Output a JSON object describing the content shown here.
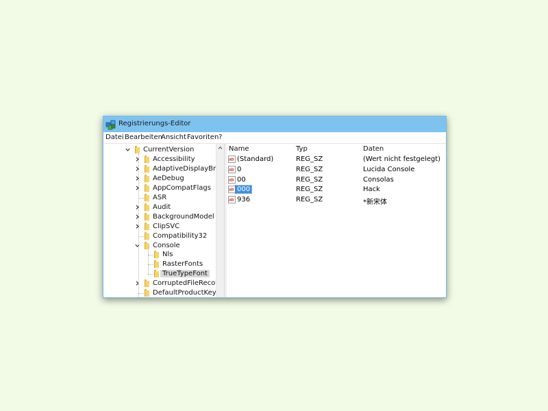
{
  "window": {
    "title": "Registrierungs-Editor"
  },
  "menu": [
    "Datei",
    "Bearbeiten",
    "Ansicht",
    "Favoriten",
    "?"
  ],
  "tree": [
    {
      "label": "CurrentVersion",
      "level": 0,
      "chevron": "down"
    },
    {
      "label": "Accessibility",
      "level": 1,
      "chevron": "right"
    },
    {
      "label": "AdaptiveDisplayBrigl",
      "level": 1,
      "chevron": "right"
    },
    {
      "label": "AeDebug",
      "level": 1,
      "chevron": "right"
    },
    {
      "label": "AppCompatFlags",
      "level": 1,
      "chevron": "right"
    },
    {
      "label": "ASR",
      "level": 1,
      "chevron": "none"
    },
    {
      "label": "Audit",
      "level": 1,
      "chevron": "right"
    },
    {
      "label": "BackgroundModel",
      "level": 1,
      "chevron": "right"
    },
    {
      "label": "ClipSVC",
      "level": 1,
      "chevron": "right"
    },
    {
      "label": "Compatibility32",
      "level": 1,
      "chevron": "none"
    },
    {
      "label": "Console",
      "level": 1,
      "chevron": "down"
    },
    {
      "label": "Nls",
      "level": 2,
      "chevron": "none"
    },
    {
      "label": "RasterFonts",
      "level": 2,
      "chevron": "none"
    },
    {
      "label": "TrueTypeFont",
      "level": 2,
      "chevron": "none",
      "selected": true
    },
    {
      "label": "CorruptedFileRecove",
      "level": 1,
      "chevron": "right"
    },
    {
      "label": "DefaultProductKey",
      "level": 1,
      "chevron": "none"
    }
  ],
  "columns": {
    "name": "Name",
    "type": "Typ",
    "data": "Daten"
  },
  "values": [
    {
      "name": "(Standard)",
      "type": "REG_SZ",
      "data": "(Wert nicht festgelegt)"
    },
    {
      "name": "0",
      "type": "REG_SZ",
      "data": "Lucida Console"
    },
    {
      "name": "00",
      "type": "REG_SZ",
      "data": "Consolas"
    },
    {
      "name": "000",
      "type": "REG_SZ",
      "data": "Hack",
      "selected": true
    },
    {
      "name": "936",
      "type": "REG_SZ",
      "data": "*新宋体"
    }
  ],
  "value_icon_text": "ab"
}
